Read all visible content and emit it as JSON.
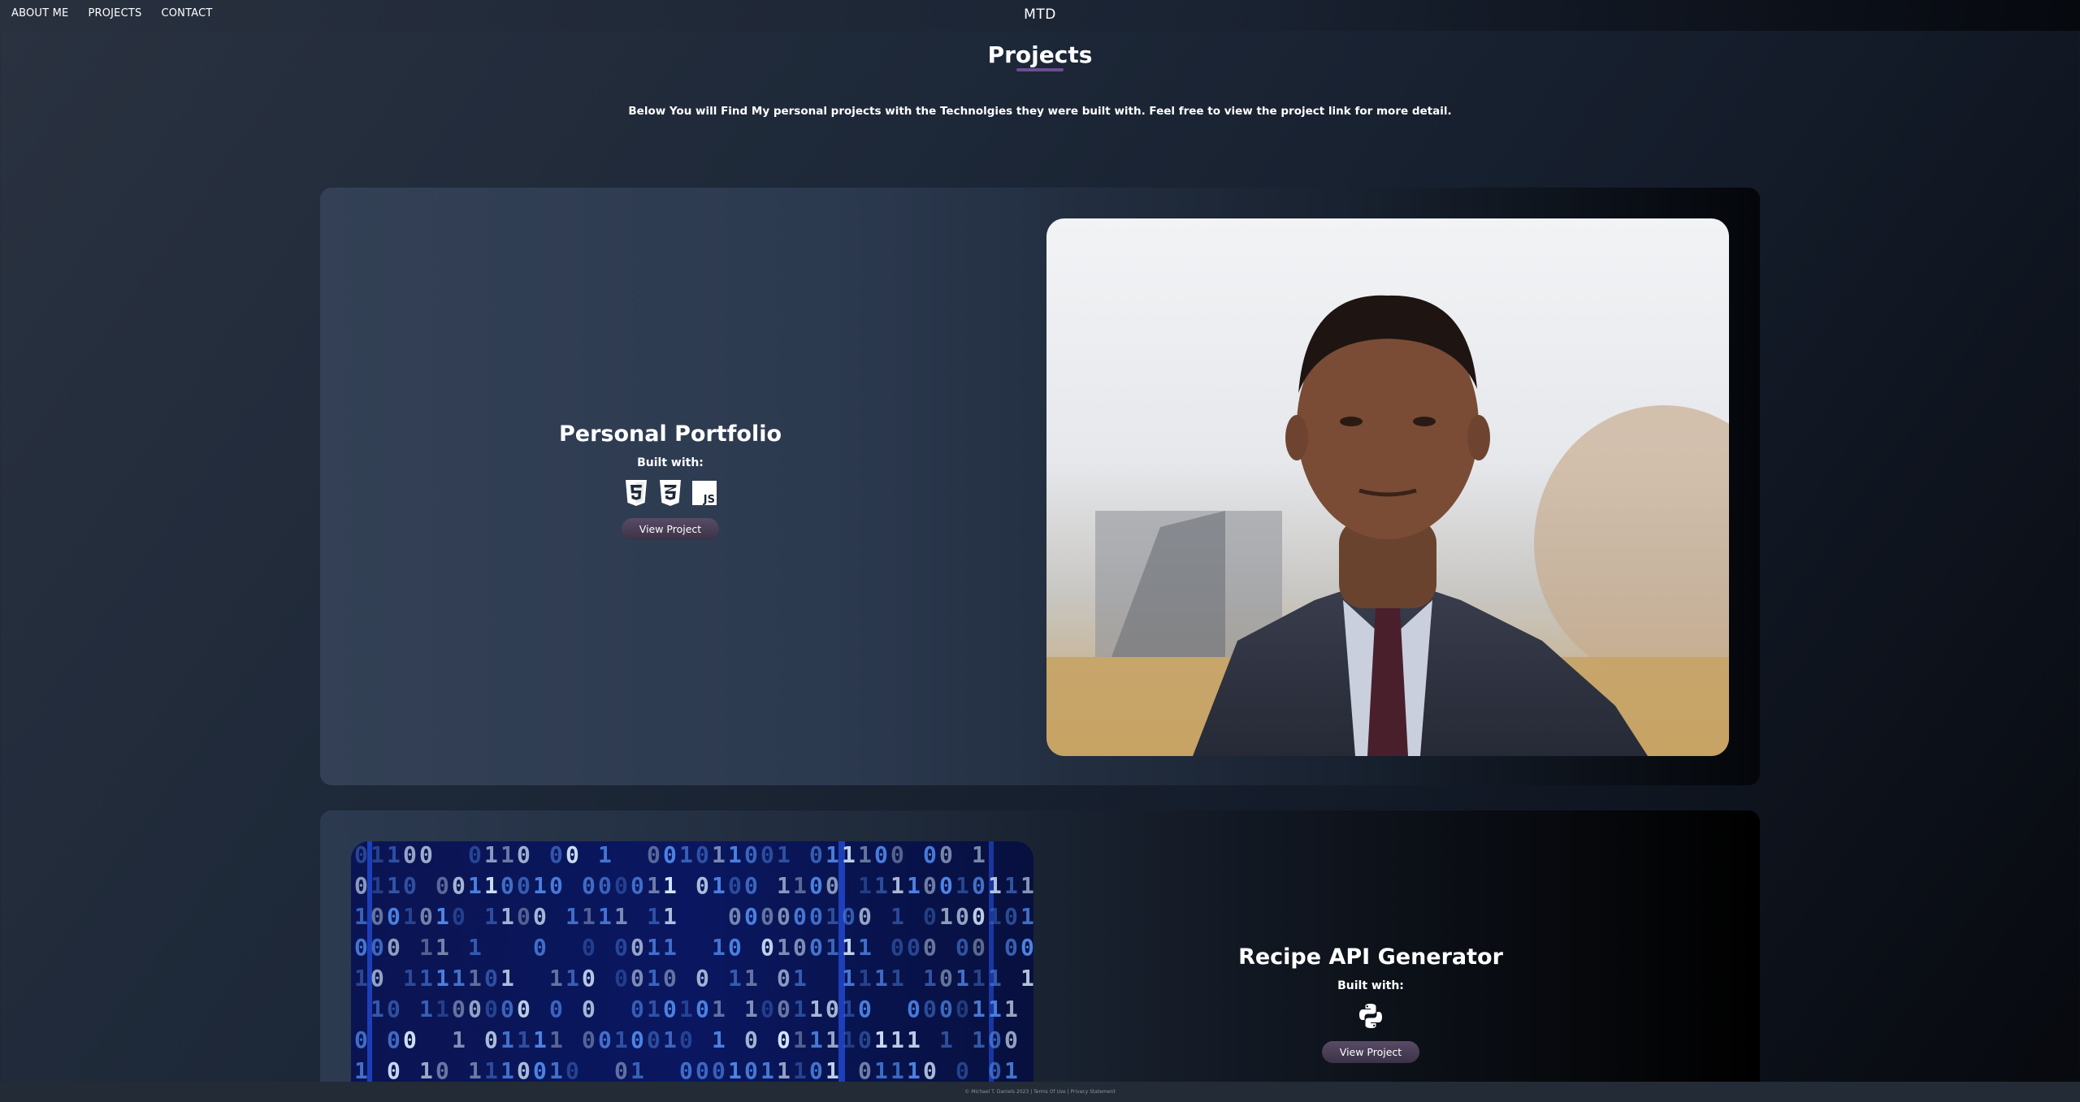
{
  "nav": {
    "links": [
      "ABOUT ME",
      "PROJECTS",
      "CONTACT"
    ],
    "brand": "MTD"
  },
  "header": {
    "title": "Projects",
    "intro": "Below You will Find My personal projects with the Technolgies they were built with. Feel free to view the project link for more detail."
  },
  "projects": [
    {
      "title": "Personal Portfolio",
      "built_label": "Built with:",
      "tech": [
        "html5-icon",
        "css3-icon",
        "javascript-icon"
      ],
      "button": "View Project"
    },
    {
      "title": "Recipe API Generator",
      "built_label": "Built with:",
      "tech": [
        "python-icon"
      ],
      "button": "View Project"
    }
  ],
  "footer": {
    "text": "© Michael T. Daniels 2023 | Terms Of Use | Privacy Statement"
  },
  "colors": {
    "accent": "#6a4f8f",
    "button": "#4a3f57"
  }
}
